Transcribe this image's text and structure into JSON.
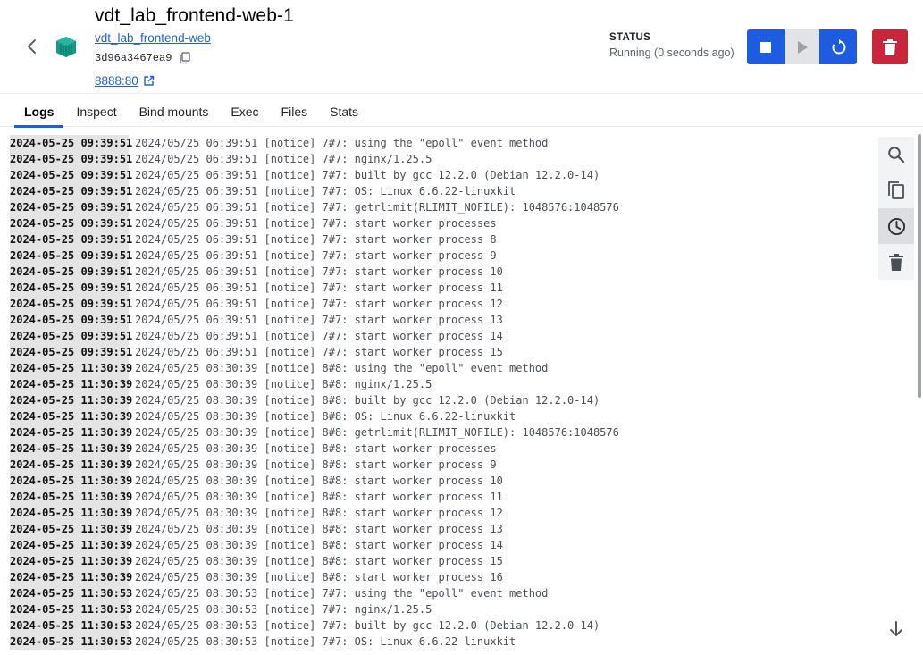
{
  "header": {
    "title": "vdt_lab_frontend-web-1",
    "image_link": "vdt_lab_frontend-web",
    "container_id": "3d96a3467ea9",
    "port": "8888:80",
    "status_label": "STATUS",
    "status_text": "Running (0 seconds ago)",
    "accent_color": "#1d5ce0",
    "delete_color": "#c8263a"
  },
  "tabs": [
    {
      "label": "Logs",
      "active": true
    },
    {
      "label": "Inspect"
    },
    {
      "label": "Bind mounts"
    },
    {
      "label": "Exec"
    },
    {
      "label": "Files"
    },
    {
      "label": "Stats"
    }
  ],
  "toolbar": {
    "icons": [
      "search-icon",
      "copy-icon",
      "clock-icon",
      "trash-icon"
    ],
    "scroll_icon": "arrow-down-icon"
  },
  "logs": [
    {
      "ts": "2024-05-25 09:39:51",
      "msg": "2024/05/25 06:39:51 [notice] 7#7: using the \"epoll\" event method"
    },
    {
      "ts": "2024-05-25 09:39:51",
      "msg": "2024/05/25 06:39:51 [notice] 7#7: nginx/1.25.5"
    },
    {
      "ts": "2024-05-25 09:39:51",
      "msg": "2024/05/25 06:39:51 [notice] 7#7: built by gcc 12.2.0 (Debian 12.2.0-14)"
    },
    {
      "ts": "2024-05-25 09:39:51",
      "msg": "2024/05/25 06:39:51 [notice] 7#7: OS: Linux 6.6.22-linuxkit"
    },
    {
      "ts": "2024-05-25 09:39:51",
      "msg": "2024/05/25 06:39:51 [notice] 7#7: getrlimit(RLIMIT_NOFILE): 1048576:1048576"
    },
    {
      "ts": "2024-05-25 09:39:51",
      "msg": "2024/05/25 06:39:51 [notice] 7#7: start worker processes"
    },
    {
      "ts": "2024-05-25 09:39:51",
      "msg": "2024/05/25 06:39:51 [notice] 7#7: start worker process 8"
    },
    {
      "ts": "2024-05-25 09:39:51",
      "msg": "2024/05/25 06:39:51 [notice] 7#7: start worker process 9"
    },
    {
      "ts": "2024-05-25 09:39:51",
      "msg": "2024/05/25 06:39:51 [notice] 7#7: start worker process 10"
    },
    {
      "ts": "2024-05-25 09:39:51",
      "msg": "2024/05/25 06:39:51 [notice] 7#7: start worker process 11"
    },
    {
      "ts": "2024-05-25 09:39:51",
      "msg": "2024/05/25 06:39:51 [notice] 7#7: start worker process 12"
    },
    {
      "ts": "2024-05-25 09:39:51",
      "msg": "2024/05/25 06:39:51 [notice] 7#7: start worker process 13"
    },
    {
      "ts": "2024-05-25 09:39:51",
      "msg": "2024/05/25 06:39:51 [notice] 7#7: start worker process 14"
    },
    {
      "ts": "2024-05-25 09:39:51",
      "msg": "2024/05/25 06:39:51 [notice] 7#7: start worker process 15"
    },
    {
      "ts": "2024-05-25 11:30:39",
      "msg": "2024/05/25 08:30:39 [notice] 8#8: using the \"epoll\" event method"
    },
    {
      "ts": "2024-05-25 11:30:39",
      "msg": "2024/05/25 08:30:39 [notice] 8#8: nginx/1.25.5"
    },
    {
      "ts": "2024-05-25 11:30:39",
      "msg": "2024/05/25 08:30:39 [notice] 8#8: built by gcc 12.2.0 (Debian 12.2.0-14)"
    },
    {
      "ts": "2024-05-25 11:30:39",
      "msg": "2024/05/25 08:30:39 [notice] 8#8: OS: Linux 6.6.22-linuxkit"
    },
    {
      "ts": "2024-05-25 11:30:39",
      "msg": "2024/05/25 08:30:39 [notice] 8#8: getrlimit(RLIMIT_NOFILE): 1048576:1048576"
    },
    {
      "ts": "2024-05-25 11:30:39",
      "msg": "2024/05/25 08:30:39 [notice] 8#8: start worker processes"
    },
    {
      "ts": "2024-05-25 11:30:39",
      "msg": "2024/05/25 08:30:39 [notice] 8#8: start worker process 9"
    },
    {
      "ts": "2024-05-25 11:30:39",
      "msg": "2024/05/25 08:30:39 [notice] 8#8: start worker process 10"
    },
    {
      "ts": "2024-05-25 11:30:39",
      "msg": "2024/05/25 08:30:39 [notice] 8#8: start worker process 11"
    },
    {
      "ts": "2024-05-25 11:30:39",
      "msg": "2024/05/25 08:30:39 [notice] 8#8: start worker process 12"
    },
    {
      "ts": "2024-05-25 11:30:39",
      "msg": "2024/05/25 08:30:39 [notice] 8#8: start worker process 13"
    },
    {
      "ts": "2024-05-25 11:30:39",
      "msg": "2024/05/25 08:30:39 [notice] 8#8: start worker process 14"
    },
    {
      "ts": "2024-05-25 11:30:39",
      "msg": "2024/05/25 08:30:39 [notice] 8#8: start worker process 15"
    },
    {
      "ts": "2024-05-25 11:30:39",
      "msg": "2024/05/25 08:30:39 [notice] 8#8: start worker process 16"
    },
    {
      "ts": "2024-05-25 11:30:53",
      "msg": "2024/05/25 08:30:53 [notice] 7#7: using the \"epoll\" event method"
    },
    {
      "ts": "2024-05-25 11:30:53",
      "msg": "2024/05/25 08:30:53 [notice] 7#7: nginx/1.25.5"
    },
    {
      "ts": "2024-05-25 11:30:53",
      "msg": "2024/05/25 08:30:53 [notice] 7#7: built by gcc 12.2.0 (Debian 12.2.0-14)"
    },
    {
      "ts": "2024-05-25 11:30:53",
      "msg": "2024/05/25 08:30:53 [notice] 7#7: OS: Linux 6.6.22-linuxkit"
    }
  ]
}
